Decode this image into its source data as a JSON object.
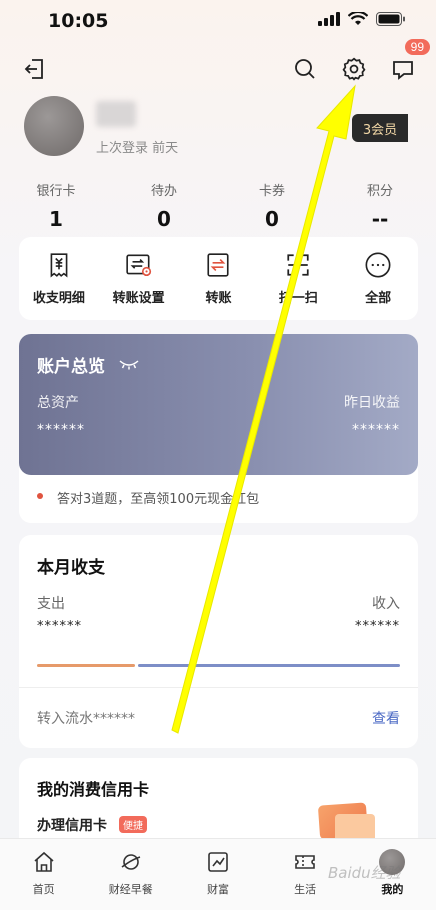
{
  "status_bar": {
    "time": "10:05"
  },
  "header": {
    "message_badge": "99"
  },
  "profile": {
    "last_login": "上次登录 前天",
    "member_label": "3会员"
  },
  "stats": [
    {
      "label": "银行卡",
      "value": "1"
    },
    {
      "label": "待办",
      "value": "0"
    },
    {
      "label": "卡券",
      "value": "0"
    },
    {
      "label": "积分",
      "value": "--"
    }
  ],
  "quick_actions": [
    {
      "label": "收支明细",
      "icon": "receipt-icon"
    },
    {
      "label": "转账设置",
      "icon": "transfer-settings-icon"
    },
    {
      "label": "转账",
      "icon": "transfer-icon"
    },
    {
      "label": "扫一扫",
      "icon": "scan-icon"
    },
    {
      "label": "全部",
      "icon": "more-icon"
    }
  ],
  "account_overview": {
    "title": "账户总览",
    "total_assets_label": "总资产",
    "total_assets_value": "******",
    "yesterday_income_label": "昨日收益",
    "yesterday_income_value": "******",
    "promo_text": "答对3道题，至高领100元现金红包"
  },
  "monthly": {
    "title": "本月收支",
    "expense_label": "支出",
    "expense_value": "******",
    "income_label": "收入",
    "income_value": "******",
    "flow_text": "转入流水******",
    "view_label": "查看"
  },
  "credit": {
    "title": "我的消费信用卡",
    "apply_label": "办理信用卡",
    "tag": "便捷"
  },
  "bottom_nav": [
    {
      "label": "首页",
      "icon": "home-icon"
    },
    {
      "label": "财经早餐",
      "icon": "planet-icon"
    },
    {
      "label": "财富",
      "icon": "chart-icon"
    },
    {
      "label": "生活",
      "icon": "ticket-icon"
    },
    {
      "label": "我的",
      "icon": "avatar"
    }
  ],
  "annotation": {
    "color": "#ffff00"
  },
  "watermark": "Baidu经验",
  "colors": {
    "accent_blue": "#4a68c4",
    "badge_red": "#f26b5b",
    "card_gradient_start": "#6f7393",
    "card_gradient_end": "#a3aac6"
  }
}
